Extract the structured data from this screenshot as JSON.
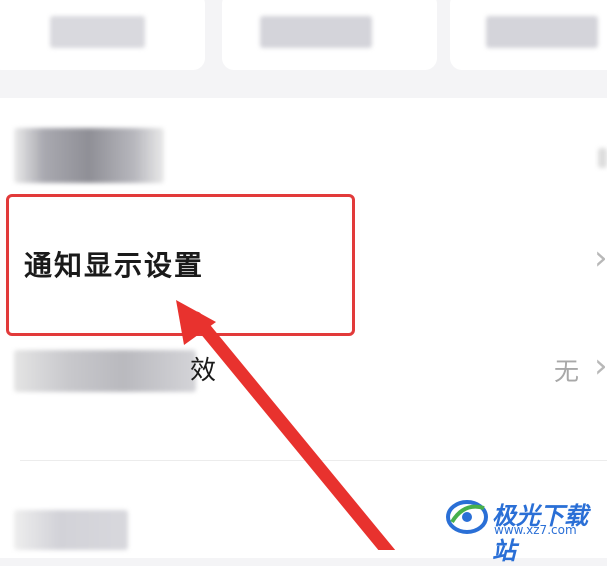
{
  "settings": {
    "notification_display": {
      "label": "通知显示设置"
    },
    "row_partial": {
      "label_tail": "效",
      "value": "无"
    }
  },
  "watermark": {
    "name": "极光下载站",
    "url": "www.xz7.com"
  },
  "colors": {
    "highlight": "#e23a3a",
    "arrow": "#e8322e",
    "watermark": "#2a6fd6"
  }
}
